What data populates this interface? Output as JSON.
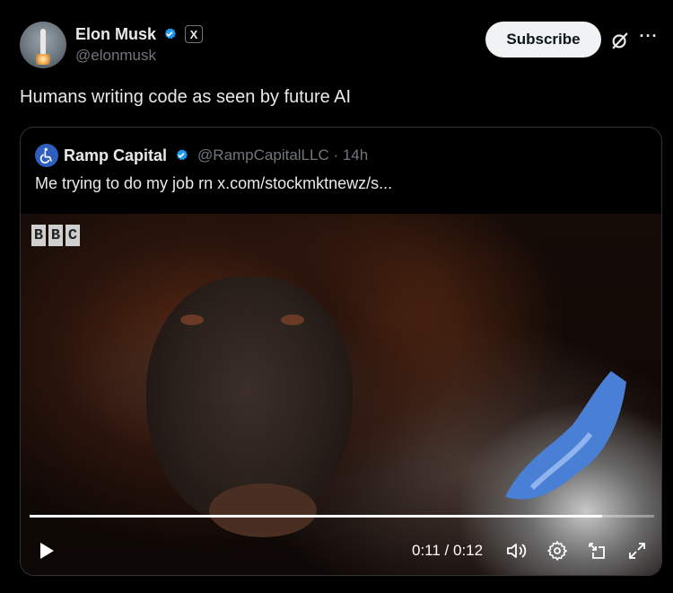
{
  "author": {
    "name": "Elon Musk",
    "handle": "@elonmusk",
    "affiliation_badge": "X"
  },
  "actions": {
    "subscribe_label": "Subscribe",
    "grok_icon": "grok-icon",
    "more_icon": "more-icon",
    "more_glyph": "···"
  },
  "post": {
    "text": "Humans writing code as seen by future AI"
  },
  "quoted": {
    "name": "Ramp Capital",
    "handle_time": "@RampCapitalLLC · 14h",
    "text": "Me trying to do my job rn  x.com/stockmktnewz/s..."
  },
  "video": {
    "watermark": [
      "B",
      "B",
      "C"
    ],
    "time_display": "0:11 / 0:12",
    "progress_fraction": 0.917
  },
  "colors": {
    "verified": "#1d9bf0",
    "background": "#000000",
    "secondary_text": "#71767b"
  }
}
